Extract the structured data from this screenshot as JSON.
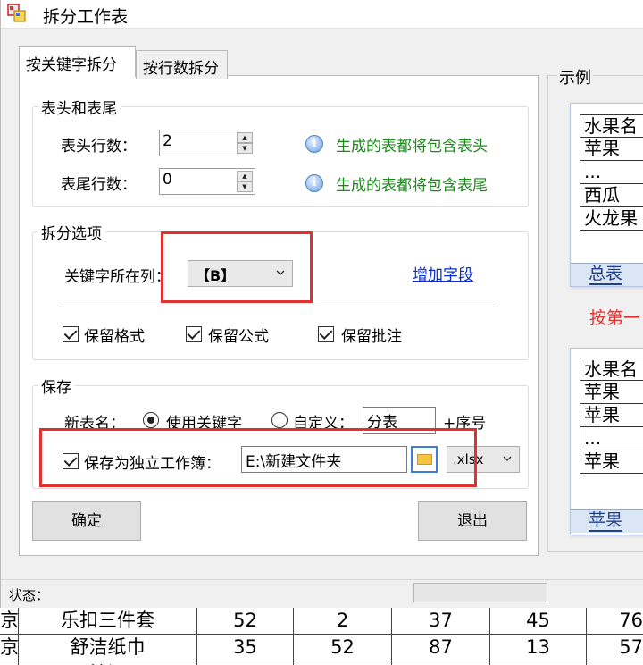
{
  "window": {
    "title": "拆分工作表"
  },
  "tabs": [
    {
      "label": "按关键字拆分",
      "active": true
    },
    {
      "label": "按行数拆分",
      "active": false
    }
  ],
  "header_footer": {
    "legend": "表头和表尾",
    "header_rows_label": "表头行数：",
    "header_rows_value": "2",
    "header_hint": "生成的表都将包含表头",
    "footer_rows_label": "表尾行数：",
    "footer_rows_value": "0",
    "footer_hint": "生成的表都将包含表尾"
  },
  "split_options": {
    "legend": "拆分选项",
    "key_column_label": "关键字所在列：",
    "key_column_value": "【B】",
    "add_field_link": "增加字段",
    "keep_format": "保留格式",
    "keep_formula": "保留公式",
    "keep_comment": "保留批注"
  },
  "save": {
    "legend": "保存",
    "new_table_name_label": "新表名：",
    "use_keyword": "使用关键字",
    "custom": "自定义：",
    "custom_value": "分表",
    "seq_suffix": "+序号",
    "save_as_workbook": "保存为独立工作簿：",
    "path_value": "E:\\新建文件夹",
    "ext_value": ".xlsx"
  },
  "buttons": {
    "ok": "确定",
    "exit": "退出"
  },
  "example": {
    "legend": "示例",
    "sheet1_rows": [
      "水果名",
      "苹果",
      "...",
      "西瓜",
      "火龙果"
    ],
    "sheet1_tab": "总表",
    "arrow_text": "按第一",
    "sheet2_rows": [
      "水果名",
      "苹果",
      "苹果",
      "...",
      "苹果"
    ],
    "sheet2_tab": "苹果"
  },
  "status": {
    "label": "状态："
  },
  "bg_table": {
    "rows": [
      [
        "京",
        "乐扣三件套",
        "52",
        "2",
        "37",
        "45",
        "76"
      ],
      [
        "京",
        "舒洁纸巾",
        "35",
        "52",
        "87",
        "13",
        "57"
      ],
      [
        "",
        "抽湿",
        "",
        "",
        "",
        "",
        ""
      ]
    ]
  },
  "colors": {
    "hint_green": "#1a8a1a",
    "highlight_red": "#e03131",
    "link_blue": "#0b2fc8"
  }
}
